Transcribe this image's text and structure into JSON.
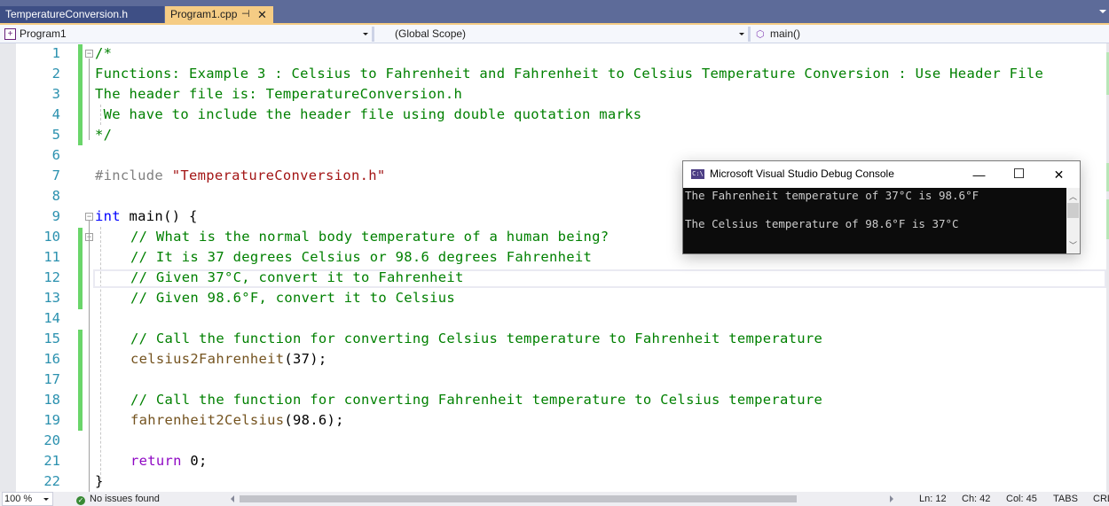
{
  "tabs": [
    {
      "label": "TemperatureConversion.h",
      "active": false
    },
    {
      "label": "Program1.cpp",
      "active": true,
      "pin_icon": "pin-icon",
      "close_icon": "close-icon"
    }
  ],
  "navbar": {
    "project": "Program1",
    "scope": "(Global Scope)",
    "member": "main()"
  },
  "editor": {
    "line_numbers": [
      "1",
      "2",
      "3",
      "4",
      "5",
      "6",
      "7",
      "8",
      "9",
      "10",
      "11",
      "12",
      "13",
      "14",
      "15",
      "16",
      "17",
      "18",
      "19",
      "20",
      "21",
      "22"
    ],
    "lines": {
      "l1": "/*",
      "l2": "Functions: Example 3 : Celsius to Fahrenheit and Fahrenheit to Celsius Temperature Conversion : Use Header File",
      "l3": "The header file is: TemperatureConversion.h",
      "l4": " We have to include the header file using double quotation marks",
      "l5": "*/",
      "l7_directive": "#include ",
      "l7_string": "\"TemperatureConversion.h\"",
      "l9_kw": "int",
      "l9_rest": " main() {",
      "l10": "// What is the normal body temperature of a human being?",
      "l11": "// It is 37 degrees Celsius or 98.6 degrees Fahrenheit",
      "l12": "// Given 37°C, convert it to Fahrenheit",
      "l13": "// Given 98.6°F, convert it to Celsius",
      "l15": "// Call the function for converting Celsius temperature to Fahrenheit temperature",
      "l16_fn": "celsius2Fahrenheit",
      "l16_args": "(37);",
      "l18": "// Call the function for converting Fahrenheit temperature to Celsius temperature",
      "l19_fn": "fahrenheit2Celsius",
      "l19_args": "(98.6);",
      "l21_kw": "return",
      "l21_rest": " 0;",
      "l22": "}"
    }
  },
  "console": {
    "title": "Microsoft Visual Studio Debug Console",
    "icon_text": "C:\\",
    "output": [
      "The Fahrenheit temperature of 37°C is 98.6°F",
      "The Celsius temperature of 98.6°F is 37°C"
    ],
    "minimize": "—",
    "maximize": "☐",
    "close": "✕"
  },
  "statusbar": {
    "zoom": "100 %",
    "issues": "No issues found",
    "ln": "Ln: 12",
    "ch": "Ch: 42",
    "col": "Col: 45",
    "indent": "TABS",
    "eol": "CRLF"
  }
}
